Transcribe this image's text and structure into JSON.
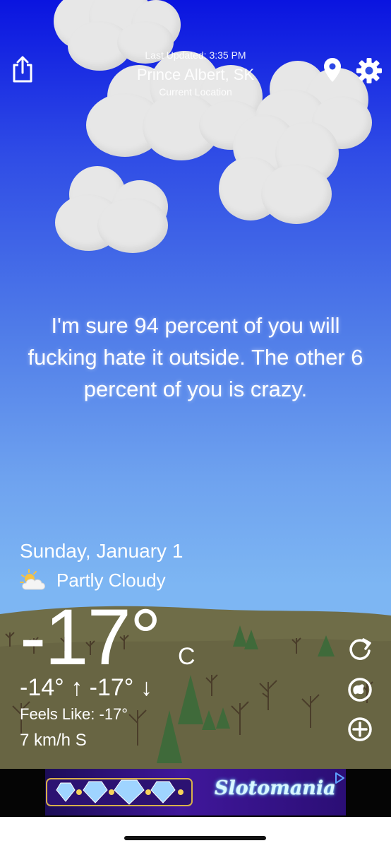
{
  "header": {
    "last_updated": "Last Updated: 3:35 PM",
    "city": "Prince Albert, SK",
    "location_label": "Current Location"
  },
  "icons": {
    "share": "share-icon",
    "location": "location-pin-icon",
    "settings": "gear-icon",
    "condition": "partly-cloudy-icon",
    "refresh": "refresh-icon",
    "radar": "radar-icon",
    "add": "add-location-icon",
    "ad_choices": "ad-choices-icon"
  },
  "quote": "I'm sure 94 percent of you will fucking hate it outside. The other 6 percent of you is crazy.",
  "weather": {
    "date": "Sunday, January 1",
    "condition": "Partly Cloudy",
    "temperature": "-17°",
    "unit": "C",
    "high": "-14°",
    "low": "-17°",
    "feels_like": "Feels Like: -17°",
    "wind": "7 km/h S"
  },
  "ad": {
    "brand": "Slotomania"
  },
  "colors": {
    "sky_top": "#0a14e0",
    "sky_bottom": "#7fb8f1",
    "ground": "#6b6a45",
    "cloud": "#e7e7e7"
  }
}
